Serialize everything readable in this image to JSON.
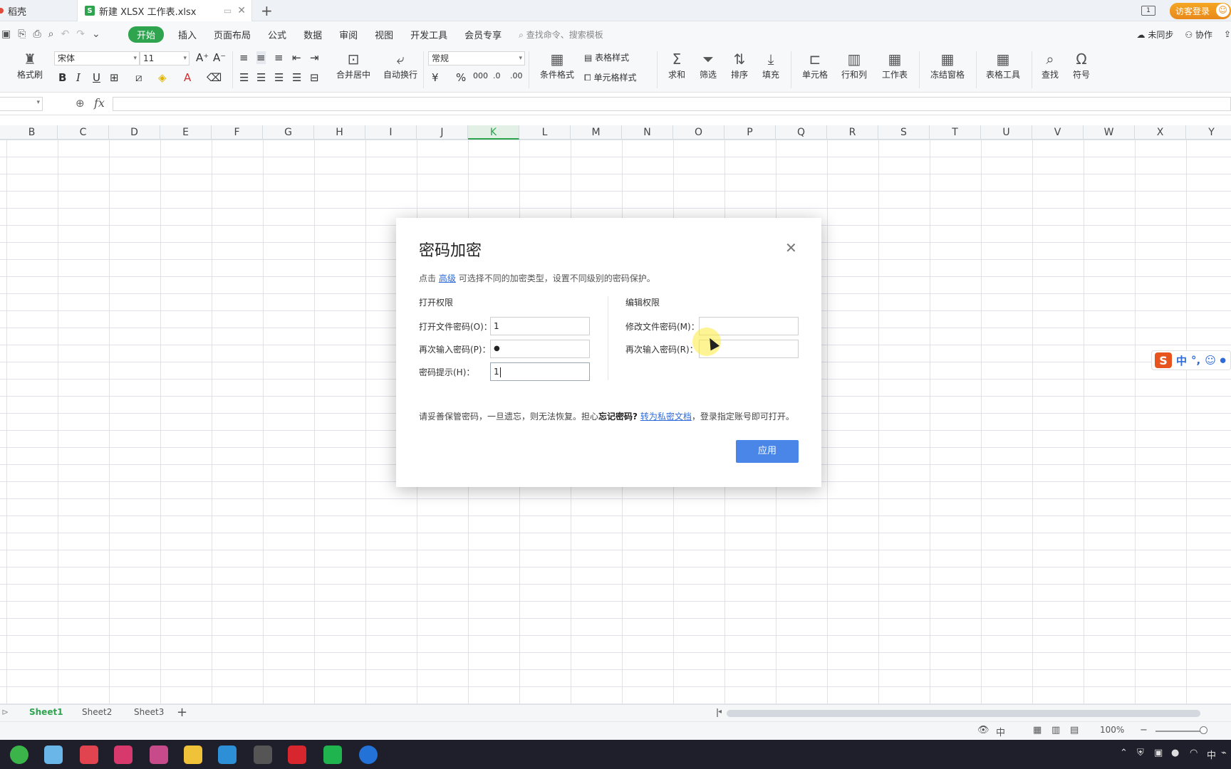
{
  "titlebar": {
    "tab_left": "稻壳",
    "file_tab": "新建 XLSX 工作表.xlsx",
    "file_icon": "S",
    "new_tab": "+",
    "window_badge": "1",
    "login": "访客登录"
  },
  "menu": {
    "items": [
      "开始",
      "插入",
      "页面布局",
      "公式",
      "数据",
      "审阅",
      "视图",
      "开发工具",
      "会员专享"
    ],
    "search_placeholder": "查找命令、搜索模板",
    "right": {
      "sync": "未同步",
      "collab": "协作"
    }
  },
  "ribbon": {
    "format_painter": "格式刷",
    "font_name": "宋体",
    "font_size": "11",
    "number_format": "常规",
    "merge": "合并居中",
    "wrap": "自动换行",
    "table_style": "表格样式",
    "cond_format": "条件格式",
    "cell_style": "单元格样式",
    "sum": "求和",
    "filter": "筛选",
    "sort": "排序",
    "fill": "填充",
    "cell": "单元格",
    "rowcol": "行和列",
    "sheet": "工作表",
    "freeze": "冻结窗格",
    "table_tools": "表格工具",
    "find": "查找",
    "symbol": "符号"
  },
  "formula": {
    "fx": "fx"
  },
  "columns": [
    "B",
    "C",
    "D",
    "E",
    "F",
    "G",
    "H",
    "I",
    "J",
    "K",
    "L",
    "M",
    "N",
    "O",
    "P",
    "Q",
    "R",
    "S",
    "T",
    "U",
    "V",
    "W",
    "X",
    "Y"
  ],
  "active_column": "K",
  "sheets": [
    "Sheet1",
    "Sheet2",
    "Sheet3"
  ],
  "status": {
    "zoom": "100%"
  },
  "dialog": {
    "title": "密码加密",
    "hint_prefix": "点击",
    "hint_link": "高级",
    "hint_suffix": "可选择不同的加密类型，设置不同级别的密码保护。",
    "open_section": "打开权限",
    "edit_section": "编辑权限",
    "open_pwd_label": "打开文件密码(O)：",
    "open_pwd_value": "1",
    "open_pwd2_label": "再次输入密码(P)：",
    "open_pwd2_value": "●",
    "hint_label": "密码提示(H)：",
    "hint_value": "1",
    "edit_pwd_label": "修改文件密码(M)：",
    "edit_pwd_value": "",
    "edit_pwd2_label": "再次输入密码(R)：",
    "edit_pwd2_value": "",
    "warn_prefix": "请妥善保管密码，一旦遗忘，则无法恢复。担心",
    "warn_bold": "忘记密码?",
    "warn_link": "转为私密文档",
    "warn_suffix": "，登录指定账号即可打开。",
    "apply": "应用"
  },
  "ime": {
    "logo": "S",
    "mode": "中"
  },
  "taskbar": {
    "ime_indicator": "中"
  },
  "colors": {
    "accent_green": "#2ea44f",
    "apply_blue": "#4a86e8",
    "link_blue": "#2f6bd8"
  }
}
